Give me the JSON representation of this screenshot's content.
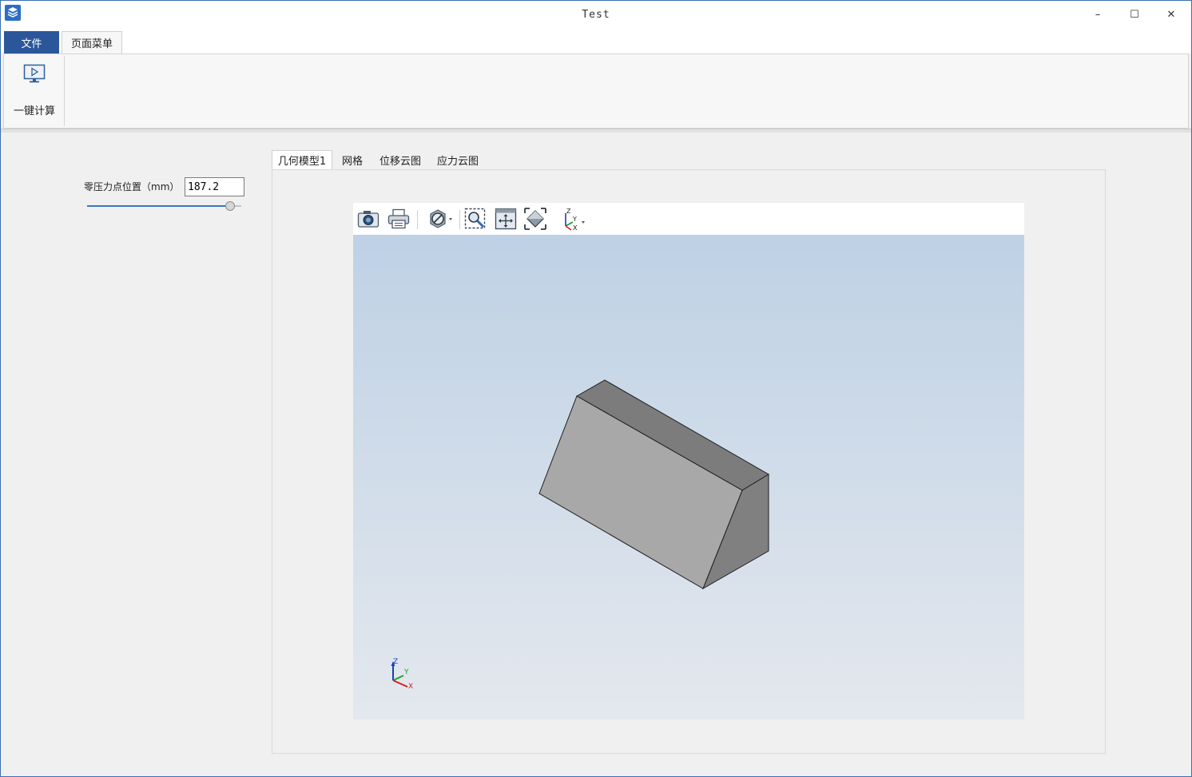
{
  "window": {
    "title": "Test",
    "minimize_glyph": "–",
    "maximize_glyph": "☐",
    "close_glyph": "✕"
  },
  "ribbon": {
    "tabs": [
      {
        "label": "文件",
        "active": false
      },
      {
        "label": "页面菜单",
        "active": true
      }
    ],
    "buttons": [
      {
        "label": "一键计算",
        "icon": "monitor-play-icon"
      }
    ]
  },
  "params": {
    "label": "零压力点位置（mm）",
    "value": "187.2",
    "slider_fraction": 0.93
  },
  "tabs": [
    {
      "label": "几何模型1",
      "active": true
    },
    {
      "label": "网格",
      "active": false
    },
    {
      "label": "位移云图",
      "active": false
    },
    {
      "label": "应力云图",
      "active": false
    }
  ],
  "viewer": {
    "toolbar": [
      "camera-icon",
      "print-icon",
      "visibility-icon",
      "zoom-window-icon",
      "pan-icon",
      "fit-view-icon",
      "view-orientation-icon"
    ],
    "background_top": "#bed1e5",
    "background_bottom": "#e4e8ee",
    "model_colors": {
      "front": "#a8a8a8",
      "top": "#7c7c7c",
      "side": "#808080"
    },
    "triad": {
      "z": "Z",
      "y": "Y",
      "x": "X"
    },
    "toolbar_axes": {
      "z": "Z",
      "y": "Y",
      "x": "X"
    }
  },
  "colors": {
    "accent": "#2b579a",
    "slider": "#3b77c4"
  }
}
